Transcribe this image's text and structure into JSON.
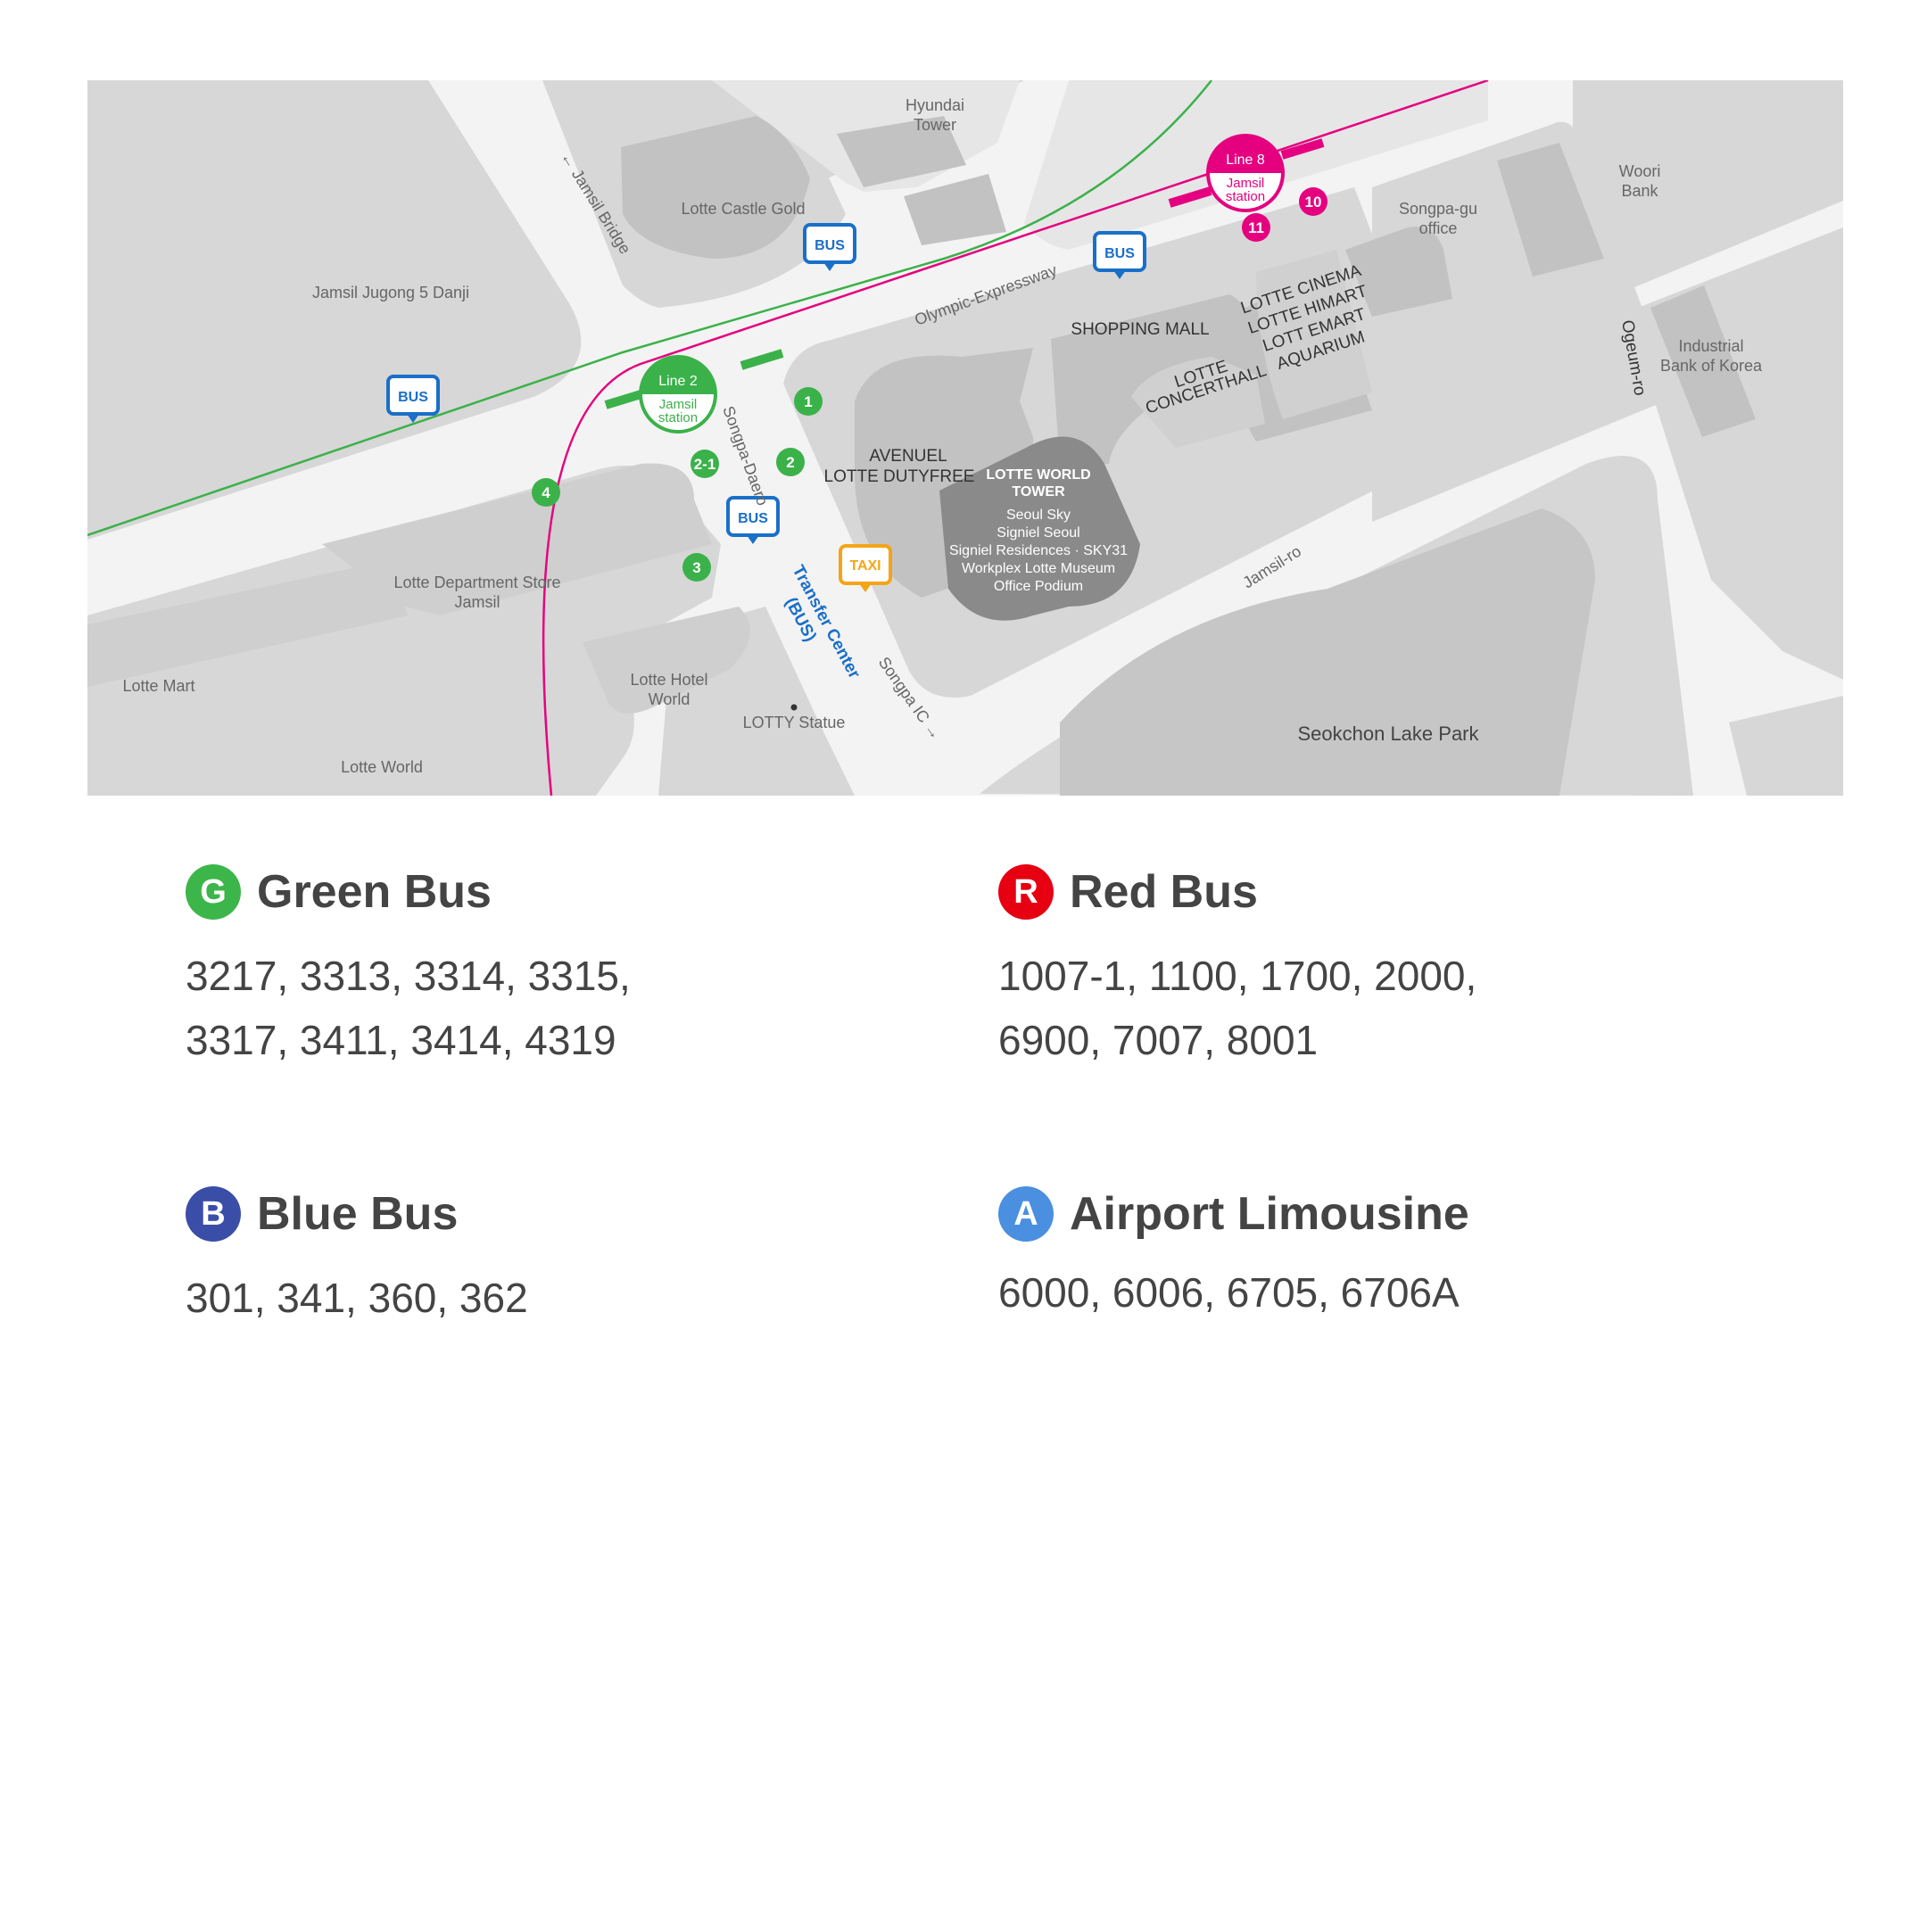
{
  "map": {
    "places": {
      "hyundai_tower": [
        "Hyundai",
        "Tower"
      ],
      "lotte_castle_gold": "Lotte Castle Gold",
      "jamsil_bridge": "← Jamsil Bridge",
      "jamsil_jugong": "Jamsil Jugong 5 Danji",
      "woori_bank": [
        "Woori",
        "Bank"
      ],
      "songpa_gu_office": [
        "Songpa-gu",
        "office"
      ],
      "industrial_bank": [
        "Industrial",
        "Bank of Korea"
      ],
      "olympic_expressway": "Olympic-Expressway",
      "shopping_mall": "SHOPPING MALL",
      "lotte_stack": [
        "LOTTE CINEMA",
        "LOTTE HIMART",
        "LOTT EMART",
        "AQUARIUM"
      ],
      "concert_hall": [
        "LOTTE",
        "CONCERTHALL"
      ],
      "ogeum_ro": "Ogeum-ro",
      "songpa_daero": "Songpa-Daero",
      "avenuel": "AVENUEL",
      "lotte_dutyfree": "LOTTE DUTYFREE",
      "tower_title": [
        "LOTTE WORLD",
        "TOWER"
      ],
      "tower_items": [
        "Seoul Sky",
        "Signiel Seoul",
        "Signiel Residences · SKY31",
        "Workplex Lotte Museum",
        "Office Podium"
      ],
      "lotte_dept_store": [
        "Lotte Department Store",
        "Jamsil"
      ],
      "lotte_mart": "Lotte Mart",
      "lotte_hotel_world": [
        "Lotte Hotel",
        "World"
      ],
      "lotty_statue": "LOTTY Statue",
      "lotte_world": "Lotte World",
      "transfer_center": [
        "Transfer Center",
        "(BUS)"
      ],
      "songpa_ic": "Songpa IC →",
      "jamsil_ro": "Jamsil-ro",
      "seokchon_lake": "Seokchon Lake Park"
    },
    "stations": {
      "line2": {
        "line": "Line 2",
        "name": [
          "Jamsil",
          "station"
        ],
        "color": "#3bb14a"
      },
      "line8": {
        "line": "Line 8",
        "name": [
          "Jamsil",
          "station"
        ],
        "color": "#e5007f"
      }
    },
    "markers": {
      "bus": "BUS",
      "taxi": "TAXI"
    },
    "exits": {
      "green": [
        "1",
        "2",
        "2-1",
        "3",
        "4"
      ],
      "pink": [
        "10",
        "11"
      ]
    },
    "colors": {
      "block": "#d7d7d7",
      "road": "#f3f3f3",
      "building": "#c2c2c2",
      "tower": "#8a8a8a",
      "bus_marker": "#1a6fc9",
      "taxi_marker": "#f3a517",
      "transfer_label": "#1a6fc9"
    }
  },
  "legend": [
    {
      "badge": "G",
      "title": "Green Bus",
      "routes": "3217, 3313, 3314, 3315, 3317, 3411, 3414, 4319",
      "color": "#3cb64a"
    },
    {
      "badge": "R",
      "title": "Red Bus",
      "routes": "1007-1, 1100, 1700, 2000, 6900, 7007, 8001",
      "color": "#e60012"
    },
    {
      "badge": "B",
      "title": "Blue Bus",
      "routes": "301, 341, 360, 362",
      "color": "#3a4ea8"
    },
    {
      "badge": "A",
      "title": "Airport Limousine",
      "routes": "6000, 6006, 6705, 6706A",
      "color": "#4a8fe0"
    }
  ]
}
